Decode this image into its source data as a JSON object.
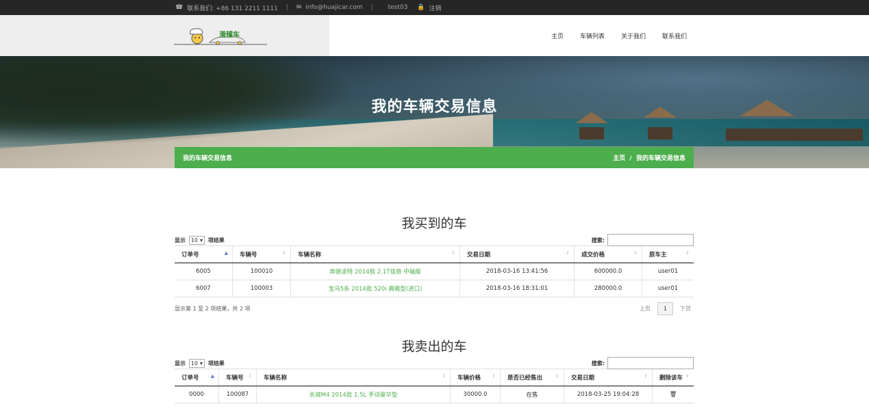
{
  "topbar": {
    "phone_label": "联系我们: +86 131 2211 1111",
    "email": "info@huajicar.com",
    "user": "test03",
    "logout": "注销"
  },
  "brand": {
    "logo_text": "滑稽车"
  },
  "nav": {
    "items": [
      "主页",
      "车辆列表",
      "关于我们",
      "联系我们"
    ]
  },
  "hero": {
    "title": "我的车辆交易信息",
    "crumb_title": "我的车辆交易信息",
    "breadcrumb": {
      "home": "主页",
      "sep": "/",
      "current": "我的车辆交易信息"
    }
  },
  "bought": {
    "title": "我买到的车",
    "show_prefix": "显示",
    "page_size": "10",
    "show_suffix": "项结果",
    "search_label": "搜索:",
    "columns": [
      "订单号",
      "车辆号",
      "车辆名称",
      "交易日期",
      "成交价格",
      "原车主"
    ],
    "rows": [
      [
        "6005",
        "100010",
        "奔驰凌特 2014款 2.1T佳旅 中轴版",
        "2018-03-16 13:41:56",
        "600000.0",
        "user01"
      ],
      [
        "6007",
        "100003",
        "宝马5系 2014款 520i 典雅型(进口)",
        "2018-03-16 18:31:01",
        "280000.0",
        "user01"
      ]
    ],
    "info": "显示第 1 至 2 项结果，共 2 项",
    "prev": "上页",
    "page": "1",
    "next": "下页"
  },
  "sold": {
    "title": "我卖出的车",
    "show_prefix": "显示",
    "page_size": "10",
    "show_suffix": "项结果",
    "search_label": "搜索:",
    "columns": [
      "订单号",
      "车辆号",
      "车辆名称",
      "车辆价格",
      "是否已经售出",
      "交易日期",
      "删除该车"
    ],
    "rows": [
      [
        "0000",
        "100087",
        "长城M4 2014款 1.5L 手动豪华型",
        "30000.0",
        "在售",
        "2018-03-25 19:04:28",
        "🗑"
      ]
    ]
  },
  "colors": {
    "accent": "#4cae4c",
    "topbar": "#262626"
  }
}
